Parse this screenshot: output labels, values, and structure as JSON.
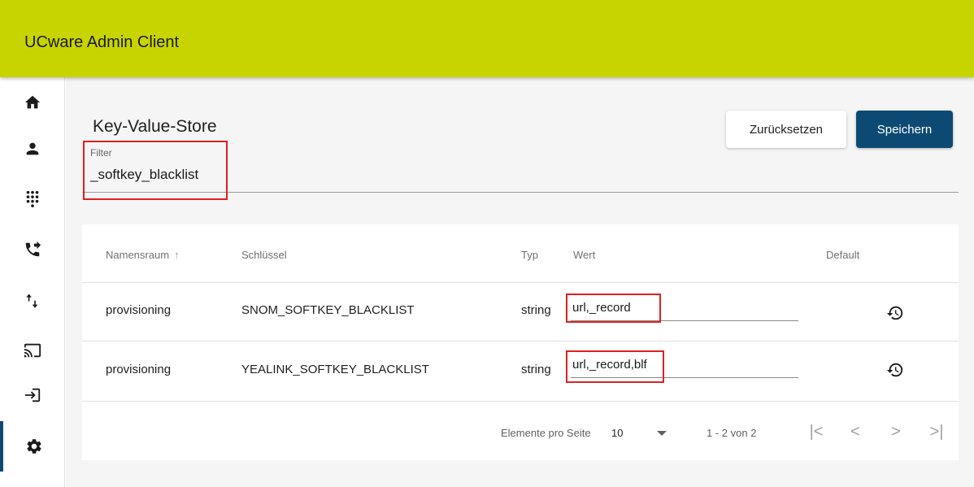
{
  "app": {
    "title": "UCware Admin Client"
  },
  "sidebar": {
    "items": [
      {
        "icon": "home-icon"
      },
      {
        "icon": "person-icon"
      },
      {
        "icon": "dialpad-icon"
      },
      {
        "icon": "phone-forward-icon"
      },
      {
        "icon": "swap-arrows-icon"
      },
      {
        "icon": "cast-icon"
      },
      {
        "icon": "login-icon"
      },
      {
        "icon": "gear-icon",
        "active": true
      }
    ]
  },
  "page": {
    "title": "Key-Value-Store",
    "reset_label": "Zurücksetzen",
    "save_label": "Speichern"
  },
  "filter": {
    "label": "Filter",
    "value": "_softkey_blacklist"
  },
  "table": {
    "columns": [
      "Namensraum",
      "Schlüssel",
      "Typ",
      "Wert",
      "Default"
    ],
    "sort_icon": "↑",
    "rows": [
      {
        "namespace": "provisioning",
        "key": "SNOM_SOFTKEY_BLACKLIST",
        "type": "string",
        "value": "url,_record"
      },
      {
        "namespace": "provisioning",
        "key": "YEALINK_SOFTKEY_BLACKLIST",
        "type": "string",
        "value": "url,_record,blf"
      }
    ]
  },
  "paginator": {
    "items_per_page_label": "Elemente pro Seite",
    "page_size": "10",
    "range_label": "1 - 2 von 2",
    "first": "|<",
    "prev": "<",
    "next": ">",
    "last": ">|"
  },
  "colors": {
    "topbar": "#c8d400",
    "primary": "#0d4a73",
    "highlight": "#e02020"
  }
}
